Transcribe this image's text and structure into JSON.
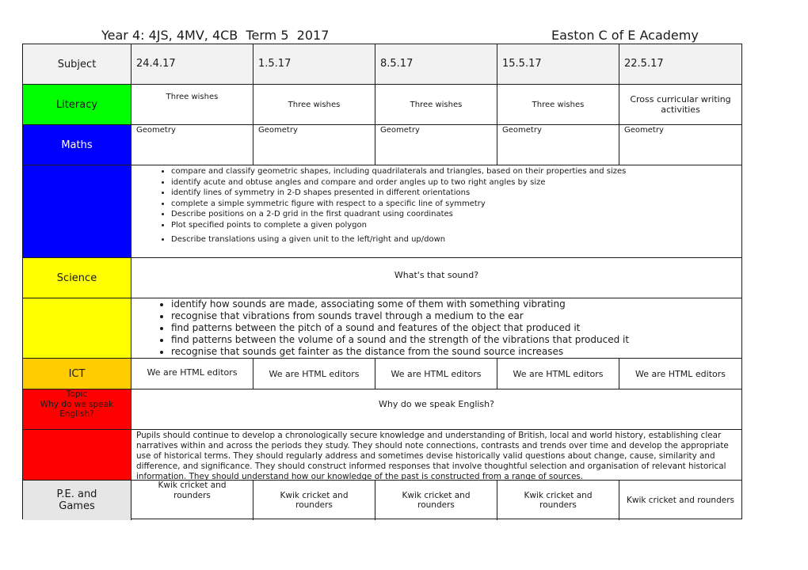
{
  "header": {
    "title": "Year 4: 4JS, 4MV, 4CB  Term 5  2017",
    "school": "Easton C of E Academy"
  },
  "colors": {
    "literacy": "#00ff00",
    "maths": "#0000ff",
    "science": "#ffff00",
    "ict": "#ffcc00",
    "topic": "#ff0000",
    "pe": "#e6e6e6",
    "header_bg": "#f2f2f2"
  },
  "table": {
    "subject_header": "Subject",
    "dates": [
      "24.4.17",
      "1.5.17",
      "8.5.17",
      "15.5.17",
      "22.5.17"
    ],
    "literacy": {
      "label": "Literacy",
      "weeks": [
        "Three wishes",
        "Three wishes",
        "Three wishes",
        "Three wishes",
        "Cross curricular writing activities"
      ]
    },
    "maths": {
      "label": "Maths",
      "weeks": [
        "Geometry",
        "Geometry",
        "Geometry",
        "Geometry",
        "Geometry"
      ],
      "objectives": [
        "compare and classify geometric shapes, including quadrilaterals and triangles, based on their properties and sizes",
        "identify acute and obtuse angles and compare and order angles up to two right angles by size",
        "identify lines of symmetry in 2-D shapes presented in different orientations",
        "complete a simple symmetric figure with respect to a specific line of symmetry",
        "Describe positions on a 2-D grid in the first quadrant using coordinates",
        "Plot specified points to complete a given polygon",
        "Describe translations using a given unit to the left/right and up/down"
      ]
    },
    "science": {
      "label": "Science",
      "unit": "What's that sound?",
      "objectives": [
        "identify how sounds are made, associating some of them with something vibrating",
        "recognise that vibrations from sounds travel through a medium to the ear",
        "find patterns between the pitch of a sound and features of the object that produced it",
        "find patterns between the volume of a sound and the strength of the vibrations that produced it",
        "recognise that sounds get fainter as the distance from the sound source increases"
      ]
    },
    "ict": {
      "label": "ICT",
      "weeks": [
        "We are HTML editors",
        "We are HTML editors",
        "We are HTML editors",
        "We are HTML editors",
        "We are HTML editors"
      ]
    },
    "topic": {
      "label_line1": "Topic",
      "label_line2": "Why do we speak English?",
      "unit": "Why do we speak English?",
      "description": "Pupils should continue to develop a chronologically secure knowledge and understanding of British, local and world history, establishing clear narratives within and across the periods they study. They should note connections, contrasts and trends over time and develop the appropriate use of historical terms. They should regularly address and sometimes devise historically valid questions about change, cause, similarity and difference, and significance. They should construct informed responses that involve thoughtful selection and organisation of relevant historical information. They should understand how our knowledge of the past is constructed from a range of sources."
    },
    "pe": {
      "label": "P.E. and Games",
      "weeks": [
        "Kwik cricket and rounders",
        "Kwik cricket and rounders",
        "Kwik cricket and rounders",
        "Kwik cricket and rounders",
        "Kwik cricket and rounders"
      ]
    }
  }
}
